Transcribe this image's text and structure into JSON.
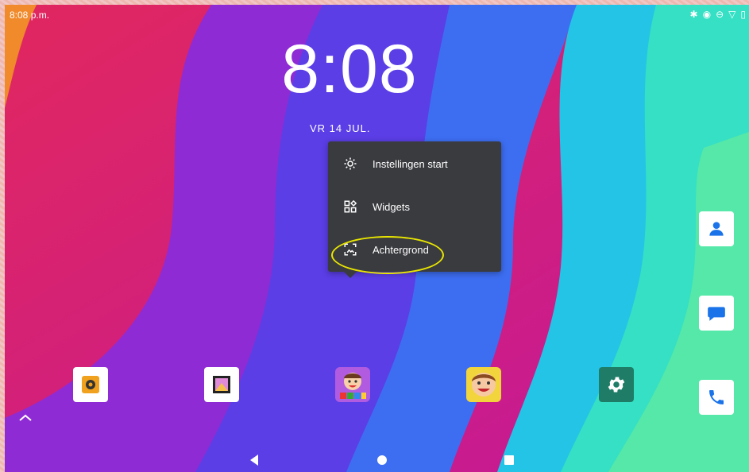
{
  "status_bar": {
    "time": "8:08 p.m.",
    "icons": [
      "bluetooth-icon",
      "vibrate-icon",
      "do-not-disturb-icon",
      "wifi-icon",
      "battery-icon"
    ]
  },
  "lock_clock": {
    "time": "8:08",
    "date": "VR 14 JUL."
  },
  "context_menu": {
    "items": [
      {
        "label": "Instellingen start",
        "icon": "settings-gear-icon"
      },
      {
        "label": "Widgets",
        "icon": "widgets-icon"
      },
      {
        "label": "Achtergrond",
        "icon": "wallpaper-icon"
      }
    ],
    "highlight_color": "#e9e600"
  },
  "dock": {
    "apps": [
      {
        "icon": "camera-app-icon"
      },
      {
        "icon": "gallery-app-icon"
      },
      {
        "icon": "kids-app-icon"
      },
      {
        "icon": "kids-face-app-icon"
      },
      {
        "icon": "settings-app-icon"
      }
    ]
  },
  "side_dock": {
    "apps": [
      {
        "icon": "contacts-app-icon"
      },
      {
        "icon": "messages-app-icon"
      },
      {
        "icon": "phone-app-icon"
      }
    ]
  },
  "navigation": {
    "buttons": [
      "back-icon",
      "home-icon",
      "recents-icon"
    ]
  },
  "colors": {
    "menu_background": "#3a3b3f",
    "menu_text": "#ffffff",
    "settings_green": "#1f7d67",
    "contacts_blue": "#1a73e8"
  }
}
